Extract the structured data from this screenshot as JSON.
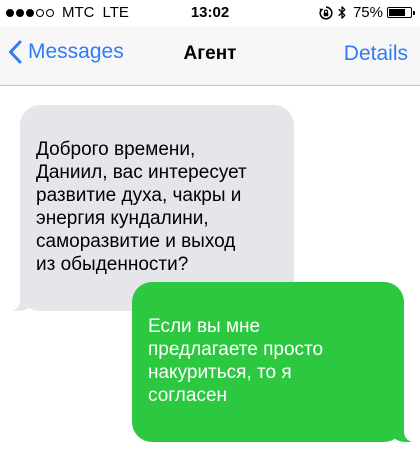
{
  "status_bar": {
    "signal_bars_filled": 3,
    "signal_bars_total": 5,
    "carrier": "МТС",
    "network": "LTE",
    "time": "13:02",
    "icons": [
      "rotation-lock-icon",
      "bluetooth-icon"
    ],
    "battery_percent": "75%",
    "battery_level": 0.75
  },
  "nav": {
    "back_label": "Messages",
    "title": "Агент",
    "details_label": "Details"
  },
  "colors": {
    "accent": "#2e7cf6",
    "incoming_bubble": "#e5e5ea",
    "outgoing_bubble": "#2bc840"
  },
  "messages": [
    {
      "direction": "incoming",
      "text": "Доброго времени,\nДаниил, вас интересует\nразвитие духа, чакры и\nэнергия кундалини,\nсаморазвитие и выход\nиз обыденности?"
    },
    {
      "direction": "outgoing",
      "text": "Если вы мне\nпредлагаете просто\nнакуриться, то я\nсогласен"
    }
  ]
}
